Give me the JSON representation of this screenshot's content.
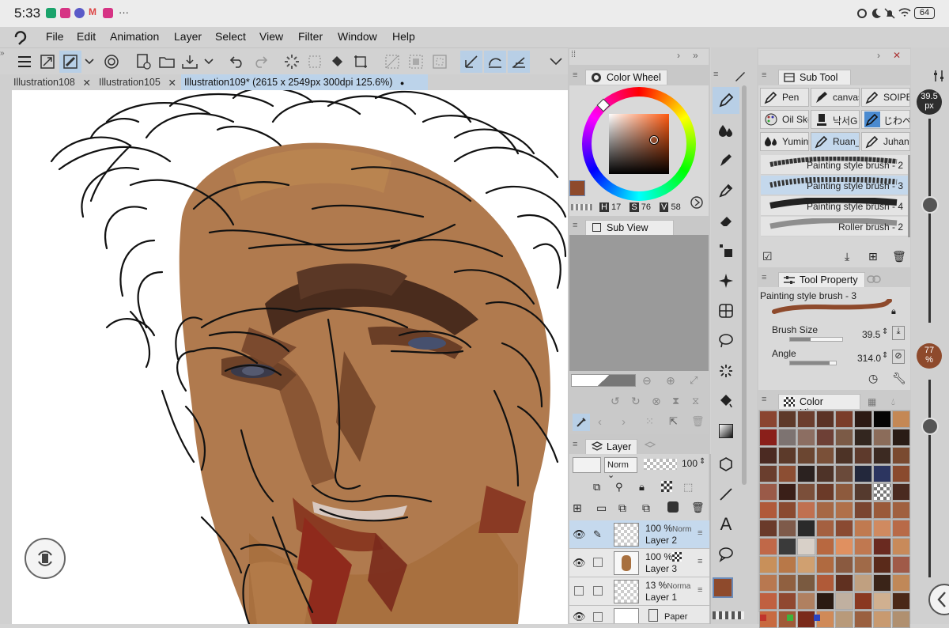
{
  "status_bar": {
    "time": "5:33",
    "more": "···",
    "battery": "64"
  },
  "menu": {
    "items": [
      "File",
      "Edit",
      "Animation",
      "Layer",
      "Select",
      "View",
      "Filter",
      "Window",
      "Help"
    ]
  },
  "doc_tabs": [
    {
      "label": "Illustration108",
      "close": "✕"
    },
    {
      "label": "Illustration105",
      "close": "✕"
    },
    {
      "label": "Illustration109* (2615 x 2549px 300dpi 125.6%)",
      "close": "●"
    }
  ],
  "color_wheel": {
    "title": "Color Wheel",
    "h_label": "H",
    "h": "17",
    "s_label": "S",
    "s": "76",
    "v_label": "V",
    "v": "58",
    "main_color": "#8e4a2c"
  },
  "sub_view": {
    "title": "Sub View"
  },
  "layer_panel": {
    "title": "Layer",
    "blend_mode": "Norm",
    "opacity": "100",
    "layers": [
      {
        "opacity": "100 %",
        "mode": "Norm",
        "name": "Layer 2",
        "selected": true
      },
      {
        "opacity": "100 %",
        "mode": "",
        "name": "Layer 3",
        "selected": false
      },
      {
        "opacity": "13 %",
        "mode": "Norma",
        "name": "Layer 1",
        "selected": false
      },
      {
        "opacity": "",
        "mode": "",
        "name": "Paper",
        "selected": false
      }
    ]
  },
  "sub_tool": {
    "title": "Sub Tool",
    "tools": [
      "Pen",
      "canvas",
      "SOIPE",
      "Oil Ske",
      "낙서G",
      "じわべ",
      "Yumin",
      "Ruan_",
      "Juhani"
    ],
    "brushes": [
      "Painting style brush - 2",
      "Painting style brush - 3",
      "Painting style brush - 4",
      "Roller brush - 2"
    ]
  },
  "tool_property": {
    "title": "Tool Property",
    "brush_name": "Painting style brush - 3",
    "brush_size_label": "Brush Size",
    "brush_size": "39.5",
    "angle_label": "Angle",
    "angle": "314.0"
  },
  "color_history": {
    "title": "Color History",
    "colors": [
      "#8a4530",
      "#5e3a2a",
      "#6b3e2e",
      "#5b3326",
      "#7a3d2a",
      "#2c1a14",
      "#050505",
      "#c48855",
      "#8a1f1a",
      "#7d7371",
      "#8c6e62",
      "#6e4036",
      "#7b5a46",
      "#33261f",
      "#8b6c5a",
      "#2a1c16",
      "#4b2a22",
      "#5c3a2a",
      "#6b4631",
      "#7a5038",
      "#4d3326",
      "#5e3a2c",
      "#3c2a22",
      "#7a4a30",
      "#6a3e2e",
      "#8c4e33",
      "#2b2220",
      "#4e3328",
      "#6a4a3a",
      "#23283c",
      "#2c3560",
      "#8a4a2e",
      "#9a5a48",
      "#3a1f18",
      "#7b4f3a",
      "#6b3a28",
      "#8d5a3d",
      "#553a2e",
      "#checker",
      "#4a2a20",
      "#b05a3a",
      "#8a4a30",
      "#c07050",
      "#a66845",
      "#b0704a",
      "#7a4530",
      "#9a5a3a",
      "#a0603f",
      "#6a3a2a",
      "#7e5a4a",
      "#2a2a2a",
      "#a46040",
      "#8a4a32",
      "#c07a50",
      "#d08a60",
      "#b86a48",
      "#c06848",
      "#3a3a3a",
      "#d8d0c8",
      "#b86840",
      "#e09060",
      "#c07850",
      "#6a2a20",
      "#c88a5a",
      "#c8905a",
      "#b87848",
      "#d0a070",
      "#b06a40",
      "#8a5a40",
      "#a06a48",
      "#5a2a1a",
      "#a05a48",
      "#b87850",
      "#906040",
      "#7a5a40",
      "#b05a38",
      "#603020",
      "#c0a080",
      "#3a2418",
      "#c08858",
      "#c06040",
      "#904830",
      "#b08060",
      "#2a1a12",
      "#c0b0a0",
      "#8a3820",
      "#d0b090",
      "#4a2818",
      "#c86a40",
      "#a05a38",
      "#7a2a1a",
      "#d08a58",
      "#b89a7a",
      "#9a6040",
      "#c89a70",
      "#b09070"
    ]
  },
  "right_rail": {
    "brush_size": "39.5",
    "brush_size_unit": "px",
    "opacity": "77",
    "opacity_unit": "%"
  }
}
